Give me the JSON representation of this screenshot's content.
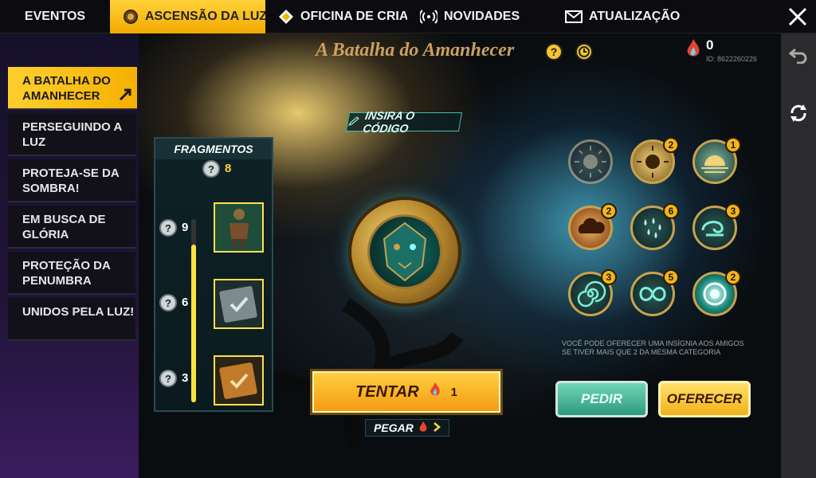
{
  "tabs": [
    {
      "label": "EVENTOS",
      "icon": "none"
    },
    {
      "label": "ASCENSÃO DA LUZ",
      "icon": "event-emblem-icon",
      "active": true
    },
    {
      "label": "OFICINA DE CRIAÇ",
      "icon": "workshop-icon"
    },
    {
      "label": "NOVIDADES",
      "icon": "broadcast-icon"
    },
    {
      "label": "ATUALIZAÇÃO",
      "icon": "mail-icon"
    }
  ],
  "sidebar": {
    "items": [
      {
        "label": "A BATALHA DO AMANHECER",
        "active": true
      },
      {
        "label": "PERSEGUINDO A LUZ"
      },
      {
        "label": "PROTEJA-SE DA SOMBRA!"
      },
      {
        "label": "EM BUSCA DE GLÓRIA"
      },
      {
        "label": "PROTEÇÃO DA PENUMBRA"
      },
      {
        "label": "UNIDOS PELA LUZ!"
      }
    ]
  },
  "header": {
    "title": "A Batalha do Amanhecer",
    "help": "?",
    "flame_count": "0",
    "player_id": "ID: 8622260226"
  },
  "code_button": "INSIRA O CÓDIGO",
  "fragments": {
    "title": "FRAGMENTOS",
    "q": "?",
    "count": "8",
    "tiers": [
      {
        "need": "9",
        "reward": "outfit"
      },
      {
        "need": "6",
        "reward": "ticket-silver"
      },
      {
        "need": "3",
        "reward": "ticket-gold"
      }
    ]
  },
  "badges": [
    {
      "count": "",
      "icon": "sun-icon",
      "dim": true
    },
    {
      "count": "2",
      "icon": "sun-icon"
    },
    {
      "count": "1",
      "icon": "sunrise-icon"
    },
    {
      "count": "2",
      "icon": "cloud-icon"
    },
    {
      "count": "6",
      "icon": "rain-icon"
    },
    {
      "count": "3",
      "icon": "wind-icon"
    },
    {
      "count": "3",
      "icon": "spiral-icon"
    },
    {
      "count": "5",
      "icon": "infinity-icon"
    },
    {
      "count": "2",
      "icon": "vortex-icon"
    }
  ],
  "note": "VOCÊ PODE OFERECER UMA INSÍGNIA AOS AMIGOS SE TIVER MAIS QUE 2 DA MESMA CATEGORIA",
  "actions": {
    "tentar": "TENTAR",
    "tentar_cost": "1",
    "pegar": "PEGAR",
    "pedir": "PEDIR",
    "oferecer": "OFERECER"
  },
  "colors": {
    "accent": "#f5b000",
    "teal": "#2e9a7e"
  }
}
